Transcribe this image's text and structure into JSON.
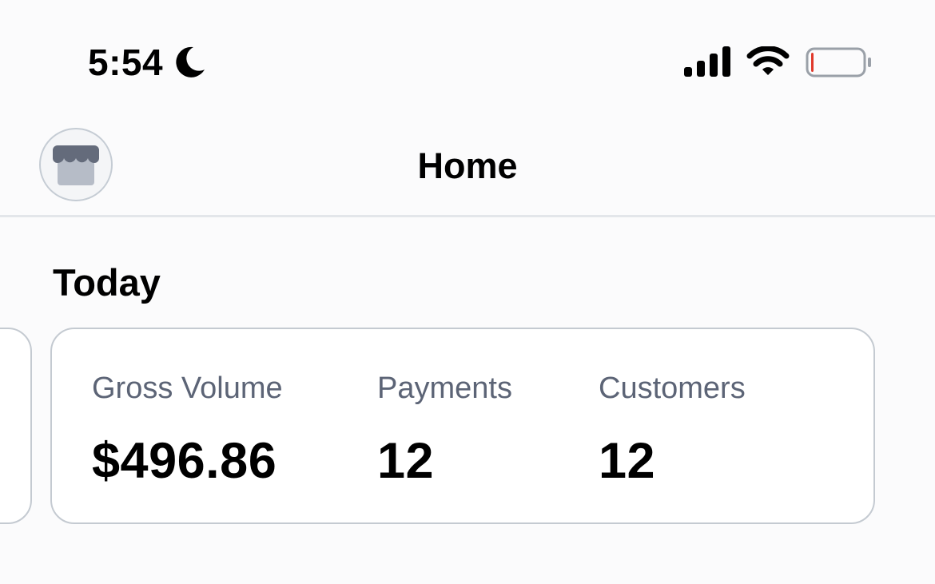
{
  "status_bar": {
    "time": "5:54",
    "icons": [
      "moon-icon",
      "signal-icon",
      "wifi-icon",
      "battery-icon"
    ],
    "battery_level": 0.05,
    "battery_low_color": "#e0392b"
  },
  "nav": {
    "title": "Home",
    "avatar_icon": "store-icon"
  },
  "today": {
    "title": "Today",
    "metrics": [
      {
        "label": "Gross Volume",
        "value": "$496.86"
      },
      {
        "label": "Payments",
        "value": "12"
      },
      {
        "label": "Customers",
        "value": "12"
      }
    ]
  },
  "colors": {
    "background": "#fbfbfc",
    "label": "#5c6476",
    "card_border": "#c4cad1",
    "divider": "#e3e6ea",
    "store_awning": "#646b7b",
    "store_body": "#b6bcc7"
  }
}
